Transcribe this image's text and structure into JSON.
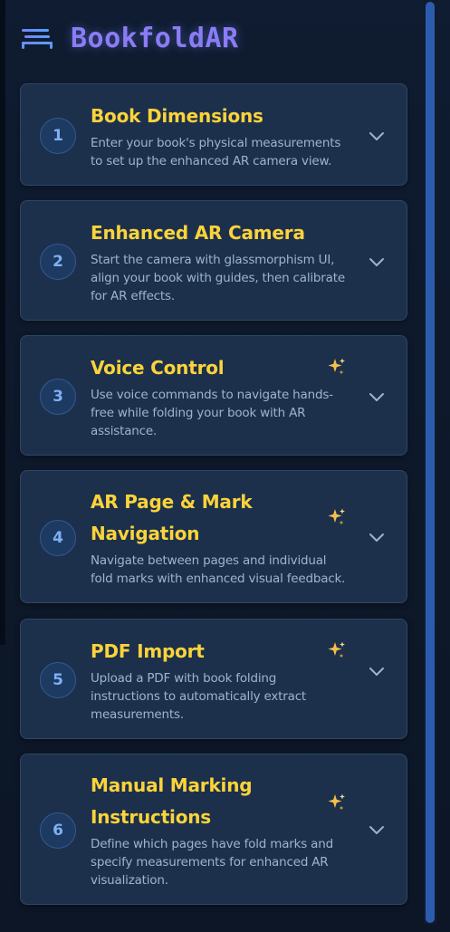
{
  "app": {
    "title": "BookfoldAR",
    "logo_icon": "stacked-lines-logo-icon"
  },
  "colors": {
    "title_gradient_start": "#8b7cf6",
    "title_gradient_end": "#5b8ff9",
    "step_title": "#fbd33a",
    "step_desc": "#9cb4cf",
    "step_number": "#7eb1f2",
    "card_bg": "#1c304c",
    "scroll_thumb": "#2c5cae"
  },
  "steps": [
    {
      "number": "1",
      "title_lines": [
        "Book Dimensions"
      ],
      "desc_lines": [
        "Enter your book's physical measurements",
        "to set up the enhanced AR camera view."
      ],
      "sparkle": false,
      "icon": "chevron-down-icon"
    },
    {
      "number": "2",
      "title_lines": [
        "Enhanced AR Camera"
      ],
      "desc_lines": [
        "Start the camera with glassmorphism UI,",
        "align your book with guides, then calibrate",
        "for AR effects."
      ],
      "sparkle": false,
      "icon": "chevron-down-icon"
    },
    {
      "number": "3",
      "title_lines": [
        "Voice Control"
      ],
      "desc_lines": [
        "Use voice commands to navigate hands-",
        "free while folding your book with AR",
        "assistance."
      ],
      "sparkle": true,
      "icon": "chevron-down-icon"
    },
    {
      "number": "4",
      "title_lines": [
        "AR Page & Mark",
        "Navigation"
      ],
      "desc_lines": [
        "Navigate between pages and individual",
        "fold marks with enhanced visual feedback."
      ],
      "sparkle": true,
      "icon": "chevron-down-icon"
    },
    {
      "number": "5",
      "title_lines": [
        "PDF Import"
      ],
      "desc_lines": [
        "Upload a PDF with book folding",
        "instructions to automatically extract",
        "measurements."
      ],
      "sparkle": true,
      "icon": "chevron-down-icon"
    },
    {
      "number": "6",
      "title_lines": [
        "Manual Marking",
        "Instructions"
      ],
      "desc_lines": [
        "Define which pages have fold marks and",
        "specify measurements for enhanced AR",
        "visualization."
      ],
      "sparkle": true,
      "icon": "chevron-down-icon"
    }
  ]
}
